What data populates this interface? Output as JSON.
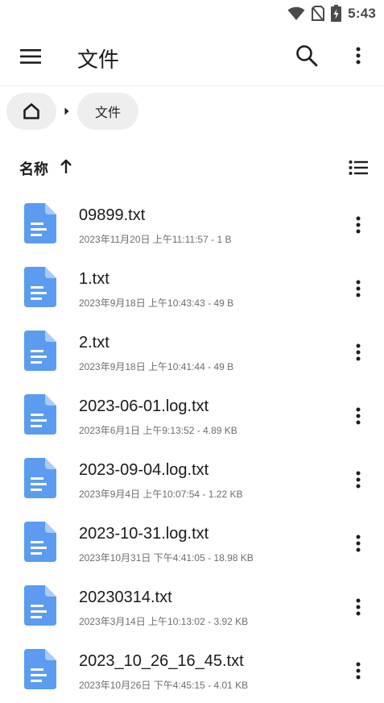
{
  "status_bar": {
    "time": "5:43",
    "icons": [
      "wifi-icon",
      "no-sim-icon",
      "battery-charging-icon"
    ]
  },
  "app_bar": {
    "menu_icon": "menu-icon",
    "title": "文件",
    "search_icon": "search-icon",
    "overflow_icon": "more-vert-icon"
  },
  "breadcrumb": {
    "home_icon": "home-icon",
    "separator_icon": "chevron-right-icon",
    "items": [
      {
        "label": "文件"
      }
    ]
  },
  "sort_bar": {
    "label": "名称",
    "direction_icon": "arrow-up-icon",
    "view_toggle_icon": "list-view-icon"
  },
  "files": [
    {
      "name": "09899.txt",
      "date": "2023年11月20日 上午11:11:57",
      "size": "1 B"
    },
    {
      "name": "1.txt",
      "date": "2023年9月18日 上午10:43:43",
      "size": "49 B"
    },
    {
      "name": "2.txt",
      "date": "2023年9月18日 上午10:41:44",
      "size": "49 B"
    },
    {
      "name": "2023-06-01.log.txt",
      "date": "2023年6月1日 上午9:13:52",
      "size": "4.89 KB"
    },
    {
      "name": "2023-09-04.log.txt",
      "date": "2023年9月4日 上午10:07:54",
      "size": "1.22 KB"
    },
    {
      "name": "2023-10-31.log.txt",
      "date": "2023年10月31日 下午4:41:05",
      "size": "18.98 KB"
    },
    {
      "name": "20230314.txt",
      "date": "2023年3月14日 上午10:13:02",
      "size": "3.92 KB"
    },
    {
      "name": "2023_10_26_16_45.txt",
      "date": "2023年10月26日 下午4:45:15",
      "size": "4.01 KB"
    }
  ],
  "meta_separator": " - ",
  "colors": {
    "file_icon": "#5b9cf0",
    "file_icon_fold": "#a9cbf7",
    "chip_bg": "#eeeeee",
    "icon_dark": "#1f1f1f",
    "status_icons": "#4a4a4a"
  }
}
